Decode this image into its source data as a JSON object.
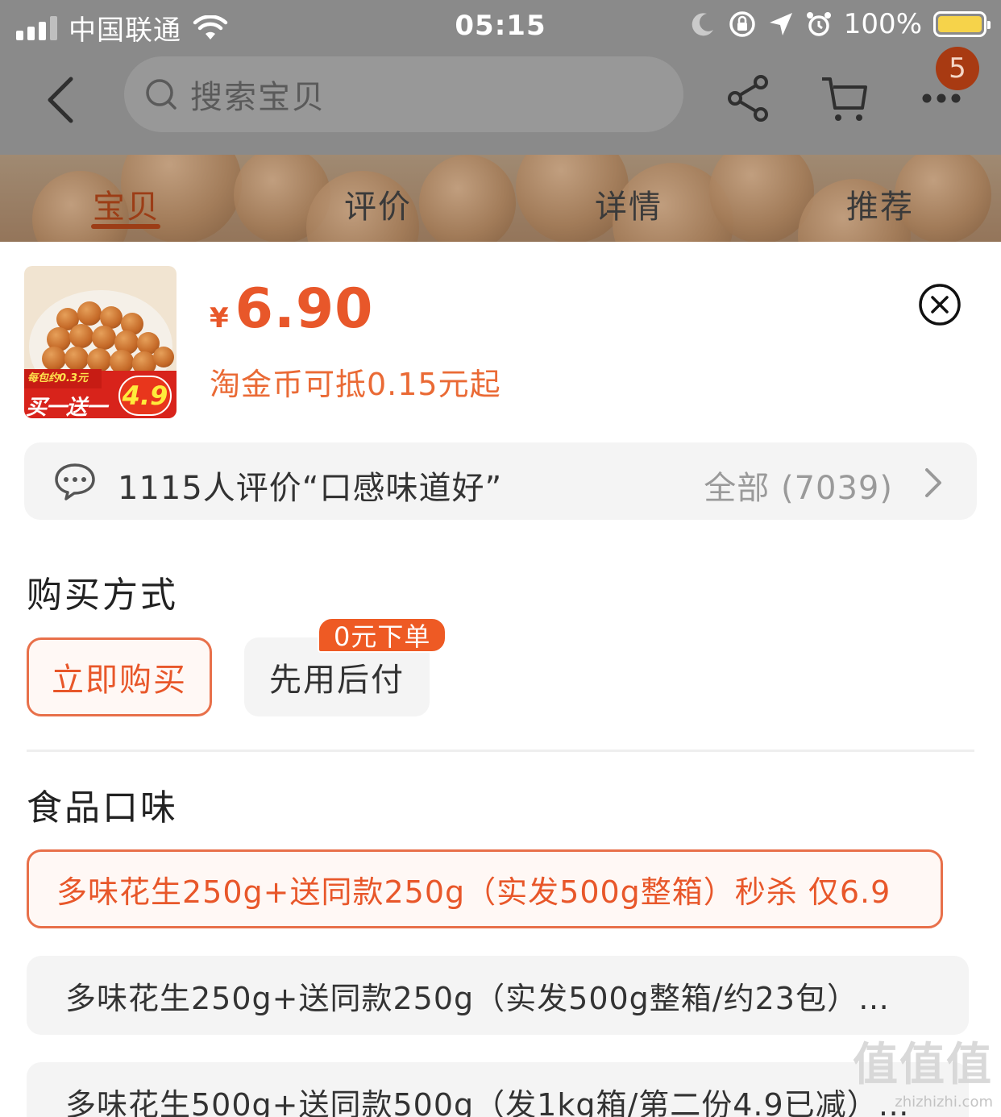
{
  "status_bar": {
    "carrier": "中国联通",
    "time": "05:15",
    "battery": "100%"
  },
  "nav": {
    "search_placeholder": "搜索宝贝",
    "badge_count": "5"
  },
  "tabs": [
    "宝贝",
    "评价",
    "详情",
    "推荐"
  ],
  "product": {
    "currency": "¥",
    "price": "6.90",
    "coin_note": "淘金币可抵0.15元起",
    "thumb": {
      "per_pack": "每包约0.3元",
      "bogo": "买一送一",
      "second_price": "4.9"
    }
  },
  "reviews": {
    "summary": "1115人评价“口感味道好”",
    "all": "全部 (7039)"
  },
  "purchase": {
    "title": "购买方式",
    "options": [
      "立即购买",
      "先用后付"
    ],
    "pay_later_tag": "0元下单"
  },
  "flavor": {
    "title": "食品口味",
    "options": [
      "多味花生250g+送同款250g（实发500g整箱）秒杀 仅6.9",
      "多味花生250g+送同款250g（实发500g整箱/约23包）…",
      "多味花生500g+送同款500g（发1kg箱/第二份4.9已减）…"
    ]
  },
  "watermark": {
    "logo": "值值值",
    "domain": "zhizhizhi.com"
  },
  "colors": {
    "accent": "#e8572a",
    "selected_border": "#e8704a",
    "tag_bg": "#ee5a24",
    "option_bg": "#f4f4f4",
    "badge_bg": "#a83a12"
  }
}
